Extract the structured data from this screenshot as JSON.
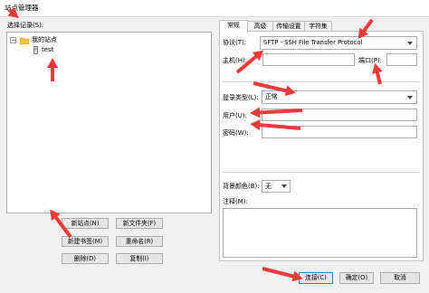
{
  "window": {
    "title": "站点管理器"
  },
  "left": {
    "select_entry_label": "选择记录(S):",
    "tree": {
      "root": "我的站点",
      "child": "test"
    },
    "buttons": {
      "new_site": "新站点(N)",
      "new_folder": "新文件夹(F)",
      "new_bookmark": "新建书签(M)",
      "rename": "重命名(R)",
      "delete": "删除(D)",
      "copy": "复制(I)"
    }
  },
  "tabs": [
    "常规",
    "高级",
    "传输设置",
    "字符集"
  ],
  "general": {
    "protocol_label": "协议(T):",
    "protocol_value": "SFTP - SSH File Transfer Protocol",
    "host_label": "主机(H):",
    "host_value": "",
    "port_label": "端口(P):",
    "port_value": "",
    "logon_type_label": "登录类型(L):",
    "logon_type_value": "正常",
    "user_label": "用户(U):",
    "user_value": "",
    "password_label": "密码(W):",
    "password_value": "",
    "bg_color_label": "背景颜色(B):",
    "bg_color_value": "无",
    "comments_label": "注释(M):",
    "comments_value": ""
  },
  "footer": {
    "connect": "连接(C)",
    "ok": "确定(O)",
    "cancel": "取消"
  },
  "colors": {
    "annotation_arrow": "#ea3a3a",
    "folder": "#f2c14e"
  }
}
